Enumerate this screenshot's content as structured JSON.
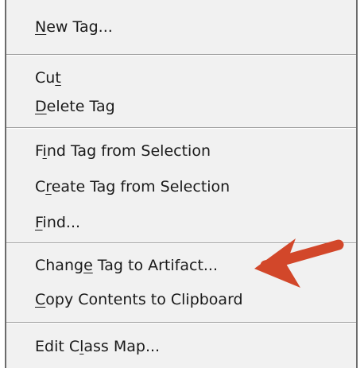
{
  "menu": {
    "items": [
      {
        "id": "new-tag",
        "before": "",
        "key": "N",
        "after": "ew Tag..."
      },
      {
        "id": "cut",
        "before": "Cu",
        "key": "t",
        "after": ""
      },
      {
        "id": "delete-tag",
        "before": "",
        "key": "D",
        "after": "elete Tag"
      },
      {
        "id": "find-tag-from-selection",
        "before": "F",
        "key": "i",
        "after": "nd Tag from Selection"
      },
      {
        "id": "create-tag-from-selection",
        "before": "C",
        "key": "r",
        "after": "eate Tag from Selection"
      },
      {
        "id": "find",
        "before": "",
        "key": "F",
        "after": "ind..."
      },
      {
        "id": "change-tag-to-artifact",
        "before": "Chang",
        "key": "e",
        "after": " Tag to Artifact..."
      },
      {
        "id": "copy-contents-to-clipboard",
        "before": "",
        "key": "C",
        "after": "opy Contents to Clipboard"
      },
      {
        "id": "edit-class-map",
        "before": "Edit C",
        "key": "l",
        "after": "ass Map..."
      }
    ]
  },
  "colors": {
    "menu_background": "#f1f1f1",
    "text": "#1a1a1a",
    "separator": "#a0a0a0",
    "annotation_arrow": "#d2472a"
  },
  "annotation": {
    "icon": "arrow-pointing-left-icon"
  }
}
